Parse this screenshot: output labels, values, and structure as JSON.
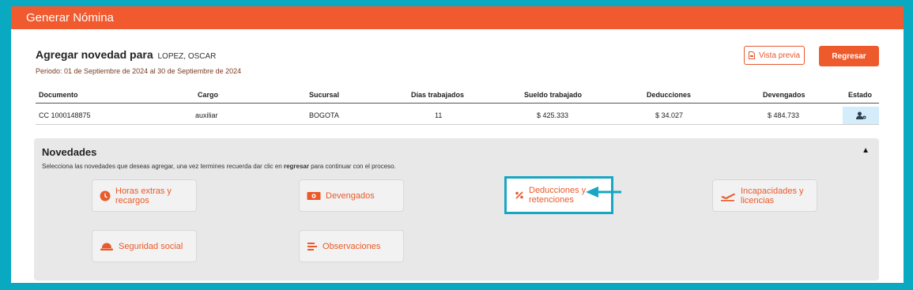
{
  "header": {
    "title": "Generar Nómina"
  },
  "novelty": {
    "heading": "Agregar novedad para",
    "employee": "LOPEZ, OSCAR",
    "period": "Periodo: 01 de Septiembre de 2024 al 30 de Septiembre de 2024"
  },
  "actions": {
    "preview_label": "Vista previa",
    "back_label": "Regresar"
  },
  "table": {
    "headers": [
      "Documento",
      "Cargo",
      "Sucursal",
      "Días trabajados",
      "Sueldo trabajado",
      "Deducciones",
      "Devengados",
      "Estado"
    ],
    "row": [
      "CC 1000148875",
      "auxiliar",
      "BOGOTA",
      "11",
      "$ 425.333",
      "$ 34.027",
      "$ 484.733"
    ]
  },
  "novedades": {
    "title": "Novedades",
    "toggle": "▲",
    "desc_before": "Selecciona las novedades que deseas agregar, una vez termines recuerda dar clic en ",
    "desc_bold": "regresar",
    "desc_after": " para continuar con el proceso.",
    "cards": [
      {
        "label": "Horas extras y recargos",
        "icon": "clock-icon"
      },
      {
        "label": "Devengados",
        "icon": "money-icon"
      },
      {
        "label": "Deducciones y retenciones",
        "icon": "percent-icon"
      },
      {
        "label": "Incapacidades y licencias",
        "icon": "plane-icon"
      },
      {
        "label": "Seguridad social",
        "icon": "hardhat-icon"
      },
      {
        "label": "Observaciones",
        "icon": "notes-icon"
      }
    ]
  },
  "colors": {
    "accent": "#f15a2e",
    "highlight": "#17a6c4"
  }
}
